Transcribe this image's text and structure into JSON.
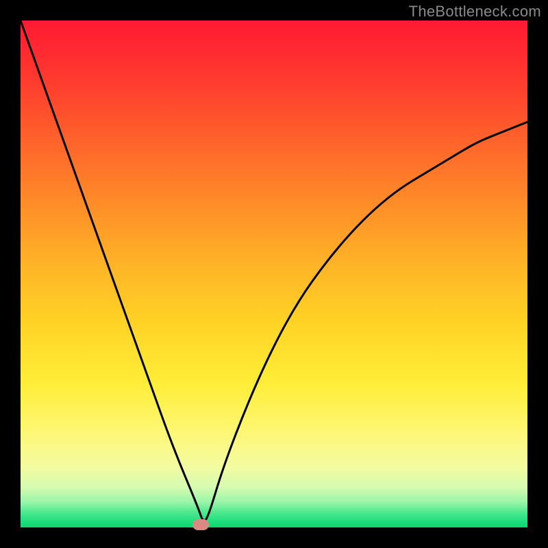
{
  "watermark": "TheBottleneck.com",
  "chart_data": {
    "type": "line",
    "title": "",
    "xlabel": "",
    "ylabel": "",
    "xlim": [
      0,
      100
    ],
    "ylim": [
      0,
      100
    ],
    "series": [
      {
        "name": "curve",
        "x": [
          0,
          5,
          10,
          15,
          20,
          25,
          30,
          35,
          36,
          37,
          40,
          45,
          50,
          55,
          60,
          65,
          70,
          75,
          80,
          85,
          90,
          95,
          100
        ],
        "values": [
          100,
          86,
          72,
          58,
          44,
          30,
          16,
          4,
          1,
          2,
          12,
          25,
          36,
          45,
          52,
          58,
          63,
          67,
          70,
          73,
          76,
          78,
          80
        ]
      }
    ],
    "markers": [
      {
        "name": "min-point",
        "x": 35.5,
        "y": 0.5
      }
    ],
    "background": {
      "type": "vertical-gradient",
      "stops": [
        {
          "pos": 0.0,
          "color": "#ff1a33"
        },
        {
          "pos": 0.5,
          "color": "#ffb327"
        },
        {
          "pos": 0.8,
          "color": "#fdf87a"
        },
        {
          "pos": 1.0,
          "color": "#0fd472"
        }
      ]
    }
  }
}
